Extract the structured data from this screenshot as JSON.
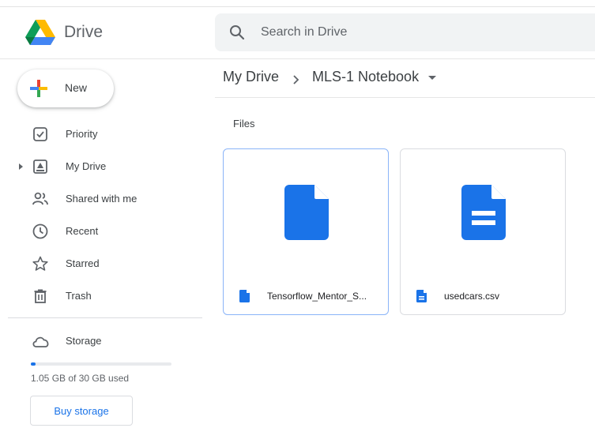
{
  "app": {
    "name": "Drive"
  },
  "search": {
    "placeholder": "Search in Drive"
  },
  "new_button": {
    "label": "New"
  },
  "sidebar": {
    "items": [
      {
        "label": "Priority",
        "icon": "priority-icon"
      },
      {
        "label": "My Drive",
        "icon": "my-drive-icon",
        "expandable": true
      },
      {
        "label": "Shared with me",
        "icon": "shared-icon"
      },
      {
        "label": "Recent",
        "icon": "clock-icon"
      },
      {
        "label": "Starred",
        "icon": "star-icon"
      },
      {
        "label": "Trash",
        "icon": "trash-icon"
      }
    ]
  },
  "storage": {
    "label": "Storage",
    "usage_text": "1.05 GB of 30 GB used",
    "used_fraction": 0.035,
    "buy_label": "Buy storage"
  },
  "breadcrumb": {
    "root": "My Drive",
    "current": "MLS-1 Notebook"
  },
  "files_section": {
    "title": "Files",
    "items": [
      {
        "name": "Tensorflow_Mentor_S...",
        "type": "doc",
        "selected": true
      },
      {
        "name": "usedcars.csv",
        "type": "sheet-doc",
        "selected": false
      }
    ]
  },
  "colors": {
    "accent": "#1a73e8",
    "file_blue": "#1a73e8",
    "text": "#3c4043"
  }
}
